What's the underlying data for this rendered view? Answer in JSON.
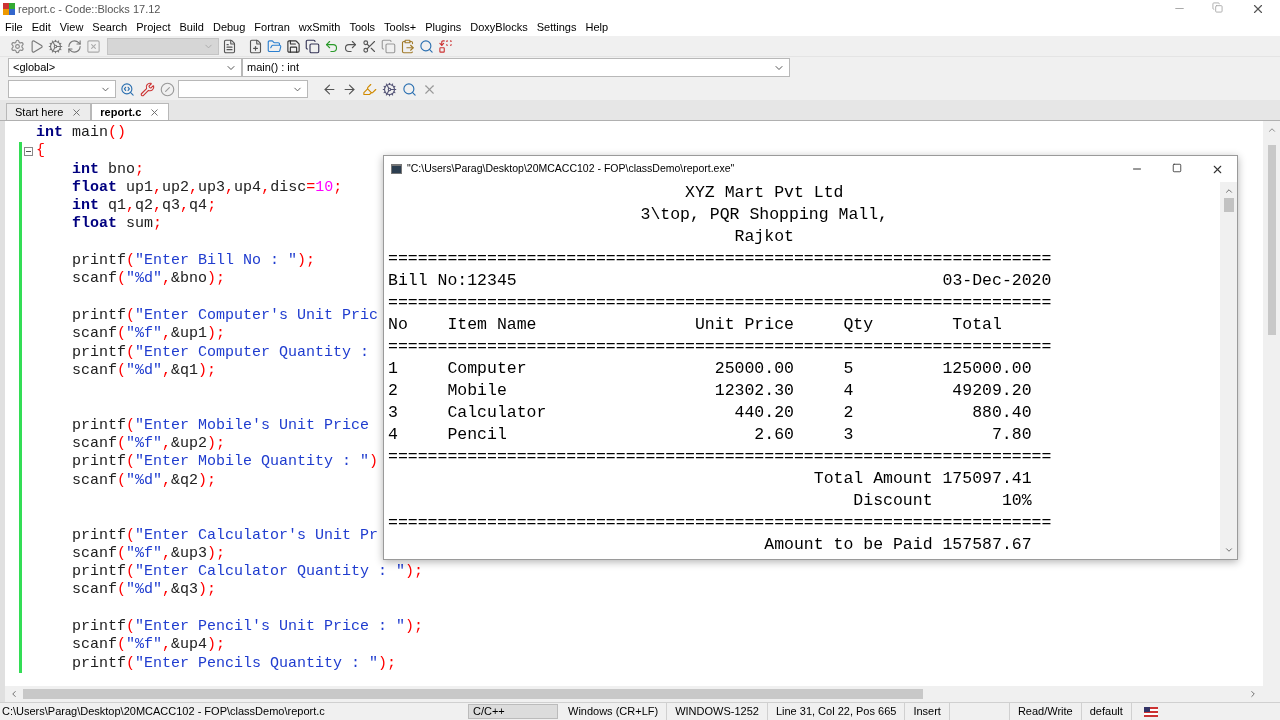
{
  "window": {
    "title": "report.c - Code::Blocks 17.12"
  },
  "menu": [
    "File",
    "Edit",
    "View",
    "Search",
    "Project",
    "Build",
    "Debug",
    "Fortran",
    "wxSmith",
    "Tools",
    "Tools+",
    "Plugins",
    "DoxyBlocks",
    "Settings",
    "Help"
  ],
  "toolbar": {
    "scope": "<global>",
    "function": "main() : int"
  },
  "tabs": [
    {
      "label": "Start here",
      "selected": false
    },
    {
      "label": "report.c",
      "selected": true
    }
  ],
  "code": {
    "header": [
      {
        "kind": "code",
        "segments": [
          {
            "kind": "kw",
            "text": "int"
          },
          {
            "kind": "id",
            "text": " main"
          },
          {
            "kind": "op",
            "text": "()"
          }
        ]
      },
      {
        "kind": "code",
        "segments": [
          {
            "kind": "op",
            "text": "{"
          }
        ]
      }
    ],
    "body": [
      {
        "kind": "code",
        "segments": [
          {
            "kind": "kw",
            "text": "int"
          },
          {
            "kind": "id",
            "text": " bno"
          },
          {
            "kind": "op",
            "text": ";"
          }
        ]
      },
      {
        "kind": "code",
        "segments": [
          {
            "kind": "kw",
            "text": "float"
          },
          {
            "kind": "id",
            "text": " up1"
          },
          {
            "kind": "op",
            "text": ","
          },
          {
            "kind": "id",
            "text": "up2"
          },
          {
            "kind": "op",
            "text": ","
          },
          {
            "kind": "id",
            "text": "up3"
          },
          {
            "kind": "op",
            "text": ","
          },
          {
            "kind": "id",
            "text": "up4"
          },
          {
            "kind": "op",
            "text": ","
          },
          {
            "kind": "id",
            "text": "disc"
          },
          {
            "kind": "op",
            "text": "="
          },
          {
            "kind": "num",
            "text": "10"
          },
          {
            "kind": "op",
            "text": ";"
          }
        ]
      },
      {
        "kind": "code",
        "segments": [
          {
            "kind": "kw",
            "text": "int"
          },
          {
            "kind": "id",
            "text": " q1"
          },
          {
            "kind": "op",
            "text": ","
          },
          {
            "kind": "id",
            "text": "q2"
          },
          {
            "kind": "op",
            "text": ","
          },
          {
            "kind": "id",
            "text": "q3"
          },
          {
            "kind": "op",
            "text": ","
          },
          {
            "kind": "id",
            "text": "q4"
          },
          {
            "kind": "op",
            "text": ";"
          }
        ]
      },
      {
        "kind": "code",
        "segments": [
          {
            "kind": "kw",
            "text": "float"
          },
          {
            "kind": "id",
            "text": " sum"
          },
          {
            "kind": "op",
            "text": ";"
          }
        ]
      },
      {
        "kind": "blank"
      },
      {
        "kind": "code",
        "segments": [
          {
            "kind": "id",
            "text": "printf"
          },
          {
            "kind": "op",
            "text": "("
          },
          {
            "kind": "str",
            "text": "\"Enter Bill No : \""
          },
          {
            "kind": "op",
            "text": ");"
          }
        ]
      },
      {
        "kind": "code",
        "segments": [
          {
            "kind": "id",
            "text": "scanf"
          },
          {
            "kind": "op",
            "text": "("
          },
          {
            "kind": "str",
            "text": "\"%d\""
          },
          {
            "kind": "op",
            "text": ","
          },
          {
            "kind": "id",
            "text": "&bno"
          },
          {
            "kind": "op",
            "text": ");"
          }
        ]
      },
      {
        "kind": "blank"
      },
      {
        "kind": "code",
        "segments": [
          {
            "kind": "id",
            "text": "printf"
          },
          {
            "kind": "op",
            "text": "("
          },
          {
            "kind": "str",
            "text": "\"Enter Computer's Unit Pric"
          }
        ]
      },
      {
        "kind": "code",
        "segments": [
          {
            "kind": "id",
            "text": "scanf"
          },
          {
            "kind": "op",
            "text": "("
          },
          {
            "kind": "str",
            "text": "\"%f\""
          },
          {
            "kind": "op",
            "text": ","
          },
          {
            "kind": "id",
            "text": "&up1"
          },
          {
            "kind": "op",
            "text": ");"
          }
        ]
      },
      {
        "kind": "code",
        "segments": [
          {
            "kind": "id",
            "text": "printf"
          },
          {
            "kind": "op",
            "text": "("
          },
          {
            "kind": "str",
            "text": "\"Enter Computer Quantity :"
          }
        ]
      },
      {
        "kind": "code",
        "segments": [
          {
            "kind": "id",
            "text": "scanf"
          },
          {
            "kind": "op",
            "text": "("
          },
          {
            "kind": "str",
            "text": "\"%d\""
          },
          {
            "kind": "op",
            "text": ","
          },
          {
            "kind": "id",
            "text": "&q1"
          },
          {
            "kind": "op",
            "text": ");"
          }
        ]
      },
      {
        "kind": "blank"
      },
      {
        "kind": "blank"
      },
      {
        "kind": "code",
        "segments": [
          {
            "kind": "id",
            "text": "printf"
          },
          {
            "kind": "op",
            "text": "("
          },
          {
            "kind": "str",
            "text": "\"Enter Mobile's Unit Price"
          }
        ]
      },
      {
        "kind": "code",
        "segments": [
          {
            "kind": "id",
            "text": "scanf"
          },
          {
            "kind": "op",
            "text": "("
          },
          {
            "kind": "str",
            "text": "\"%f\""
          },
          {
            "kind": "op",
            "text": ","
          },
          {
            "kind": "id",
            "text": "&up2"
          },
          {
            "kind": "op",
            "text": ");"
          }
        ]
      },
      {
        "kind": "code",
        "segments": [
          {
            "kind": "id",
            "text": "printf"
          },
          {
            "kind": "op",
            "text": "("
          },
          {
            "kind": "str",
            "text": "\"Enter Mobile Quantity : \""
          },
          {
            "kind": "op",
            "text": ")"
          }
        ]
      },
      {
        "kind": "code",
        "segments": [
          {
            "kind": "id",
            "text": "scanf"
          },
          {
            "kind": "op",
            "text": "("
          },
          {
            "kind": "str",
            "text": "\"%d\""
          },
          {
            "kind": "op",
            "text": ","
          },
          {
            "kind": "id",
            "text": "&q2"
          },
          {
            "kind": "op",
            "text": ");"
          }
        ]
      },
      {
        "kind": "blank"
      },
      {
        "kind": "blank"
      },
      {
        "kind": "code",
        "segments": [
          {
            "kind": "id",
            "text": "printf"
          },
          {
            "kind": "op",
            "text": "("
          },
          {
            "kind": "str",
            "text": "\"Enter Calculator's Unit Pr"
          }
        ]
      },
      {
        "kind": "code",
        "segments": [
          {
            "kind": "id",
            "text": "scanf"
          },
          {
            "kind": "op",
            "text": "("
          },
          {
            "kind": "str",
            "text": "\"%f\""
          },
          {
            "kind": "op",
            "text": ","
          },
          {
            "kind": "id",
            "text": "&up3"
          },
          {
            "kind": "op",
            "text": ");"
          }
        ]
      },
      {
        "kind": "code",
        "segments": [
          {
            "kind": "id",
            "text": "printf"
          },
          {
            "kind": "op",
            "text": "("
          },
          {
            "kind": "str",
            "text": "\"Enter Calculator Quantity : \""
          },
          {
            "kind": "op",
            "text": ");"
          }
        ]
      },
      {
        "kind": "code",
        "segments": [
          {
            "kind": "id",
            "text": "scanf"
          },
          {
            "kind": "op",
            "text": "("
          },
          {
            "kind": "str",
            "text": "\"%d\""
          },
          {
            "kind": "op",
            "text": ","
          },
          {
            "kind": "id",
            "text": "&q3"
          },
          {
            "kind": "op",
            "text": ");"
          }
        ]
      },
      {
        "kind": "blank"
      },
      {
        "kind": "code",
        "segments": [
          {
            "kind": "id",
            "text": "printf"
          },
          {
            "kind": "op",
            "text": "("
          },
          {
            "kind": "str",
            "text": "\"Enter Pencil's Unit Price : \""
          },
          {
            "kind": "op",
            "text": ");"
          }
        ]
      },
      {
        "kind": "code",
        "segments": [
          {
            "kind": "id",
            "text": "scanf"
          },
          {
            "kind": "op",
            "text": "("
          },
          {
            "kind": "str",
            "text": "\"%f\""
          },
          {
            "kind": "op",
            "text": ","
          },
          {
            "kind": "id",
            "text": "&up4"
          },
          {
            "kind": "op",
            "text": ");"
          }
        ]
      },
      {
        "kind": "code",
        "segments": [
          {
            "kind": "id",
            "text": "printf"
          },
          {
            "kind": "op",
            "text": "("
          },
          {
            "kind": "str",
            "text": "\"Enter Pencils Quantity : \""
          },
          {
            "kind": "op",
            "text": ");"
          }
        ]
      }
    ]
  },
  "console": {
    "title": "\"C:\\Users\\Parag\\Desktop\\20MCACC102 - FOP\\classDemo\\report.exe\"",
    "lines": [
      {
        "kind": "center",
        "text": "XYZ Mart Pvt Ltd"
      },
      {
        "kind": "center",
        "text": "3\\top, PQR Shopping Mall,"
      },
      {
        "kind": "center",
        "text": "Rajkot"
      },
      {
        "kind": "rule",
        "text": "==================================================================="
      },
      {
        "kind": "split",
        "left": "Bill No:12345",
        "right": "03-Dec-2020"
      },
      {
        "kind": "rule",
        "text": "==================================================================="
      },
      {
        "kind": "header",
        "cells": [
          "No",
          "Item Name",
          "Unit Price",
          "Qty",
          "Total"
        ]
      },
      {
        "kind": "rule",
        "text": "==================================================================="
      },
      {
        "kind": "item",
        "cells": [
          "1",
          "Computer",
          "25000.00",
          "5",
          "125000.00"
        ]
      },
      {
        "kind": "item",
        "cells": [
          "2",
          "Mobile",
          "12302.30",
          "4",
          "49209.20"
        ]
      },
      {
        "kind": "item",
        "cells": [
          "3",
          "Calculator",
          "440.20",
          "2",
          "880.40"
        ]
      },
      {
        "kind": "item",
        "cells": [
          "4",
          "Pencil",
          "2.60",
          "3",
          "7.80"
        ]
      },
      {
        "kind": "rule",
        "text": "==================================================================="
      },
      {
        "kind": "summary",
        "label": "Total Amount",
        "value": "175097.41"
      },
      {
        "kind": "summary",
        "label": "Discount",
        "value": "10%"
      },
      {
        "kind": "rule",
        "text": "==================================================================="
      },
      {
        "kind": "summary",
        "label": "Amount to be Paid",
        "value": "157587.67"
      }
    ]
  },
  "status_bar": [
    {
      "kind": "path",
      "text": "C:\\Users\\Parag\\Desktop\\20MCACC102 - FOP\\classDemo\\report.c"
    },
    {
      "kind": "boxed",
      "text": "C/C++"
    },
    {
      "kind": "plain",
      "text": "Windows (CR+LF)"
    },
    {
      "kind": "plain",
      "text": "WINDOWS-1252"
    },
    {
      "kind": "plain",
      "text": "Line 31, Col 22, Pos 665"
    },
    {
      "kind": "plain",
      "text": "Insert"
    },
    {
      "kind": "empty"
    },
    {
      "kind": "plain",
      "text": "Read/Write"
    },
    {
      "kind": "plain",
      "text": "default"
    },
    {
      "kind": "flag"
    }
  ]
}
